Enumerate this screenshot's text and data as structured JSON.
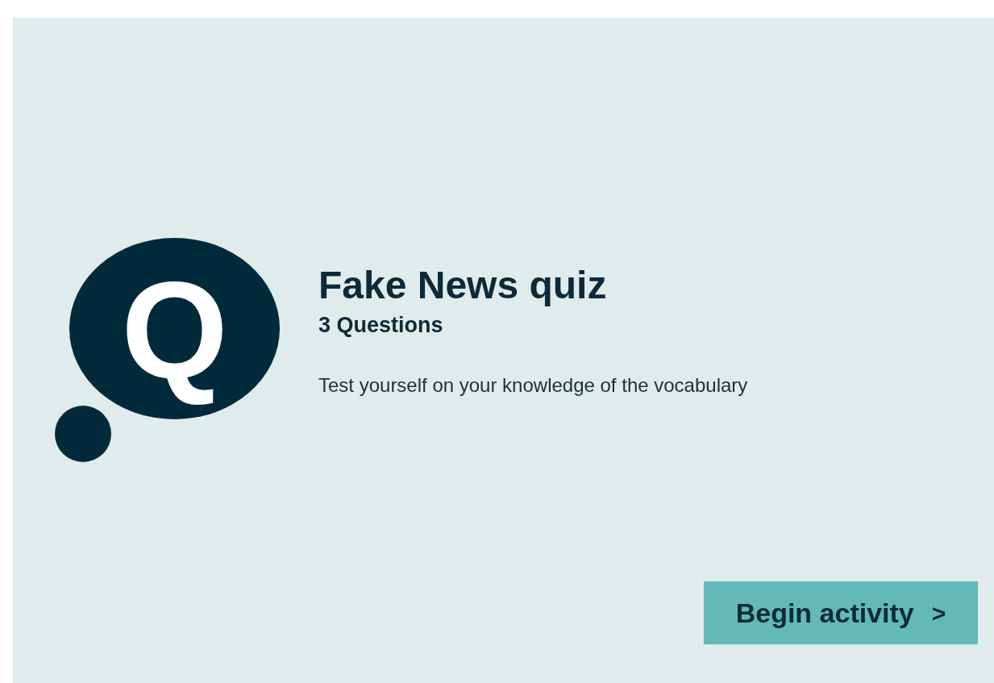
{
  "logo": {
    "letter": "Q"
  },
  "title": "Fake News quiz",
  "subtitle": "3 Questions",
  "description": "Test yourself on your knowledge of the vocabulary",
  "button": {
    "label": "Begin activity",
    "arrow": ">"
  }
}
